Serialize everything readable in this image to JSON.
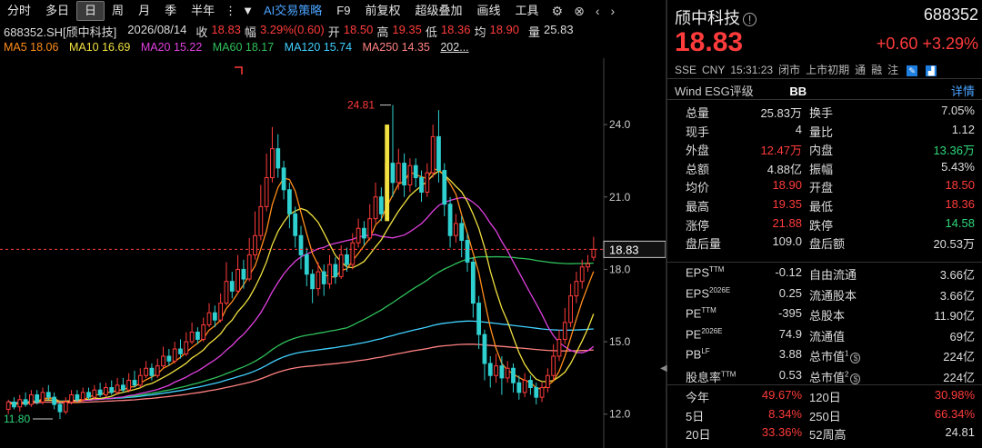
{
  "toolbar": {
    "items": [
      "分时",
      "多日",
      "日",
      "周",
      "月",
      "季",
      "半年",
      "⋮",
      "▼",
      "AI交易策略",
      "F9",
      "前复权",
      "超级叠加",
      "画线",
      "工具"
    ],
    "active": "日"
  },
  "info": {
    "code": "688352.SH[颀中科技]",
    "date": "2026/08/14",
    "close_label": "收",
    "close": "18.83",
    "amp_label": "幅",
    "amp": "3.29%(0.60)",
    "open_label": "开",
    "open": "18.50",
    "high_label": "高",
    "high": "19.35",
    "low_label": "低",
    "low": "18.36",
    "avg_label": "均",
    "avg": "18.90",
    "vol_label": "量",
    "vol": "25.83"
  },
  "ma": {
    "ma5": "MA5 18.06",
    "ma10": "MA10 16.69",
    "ma20": "MA20 15.22",
    "ma60": "MA60 18.17",
    "ma120": "MA120 15.74",
    "ma250": "MA250 14.35",
    "more": "202..."
  },
  "colors": {
    "up": "#ff3b3b",
    "down": "#2fd0d0",
    "ma5": "#ff8c1a",
    "ma10": "#f0e040",
    "ma20": "#e040e0",
    "ma60": "#2fc05a",
    "ma120": "#40d0ff",
    "ma250": "#ff8080"
  },
  "chart_data": {
    "type": "candlestick",
    "yticks": [
      "24.0",
      "21.0",
      "18.0",
      "15.0",
      "12.0"
    ],
    "ylim": [
      11.5,
      26.0
    ],
    "current_price_label": "18.83",
    "high_marker": "24.81",
    "low_marker": "11.80",
    "candles": [
      [
        12.2,
        12.5,
        12.0,
        12.6
      ],
      [
        12.5,
        12.3,
        12.2,
        12.7
      ],
      [
        12.3,
        12.6,
        12.1,
        12.8
      ],
      [
        12.6,
        12.4,
        12.3,
        12.9
      ],
      [
        12.4,
        12.8,
        12.3,
        13.0
      ],
      [
        12.8,
        12.5,
        12.4,
        13.0
      ],
      [
        12.5,
        12.9,
        12.4,
        13.1
      ],
      [
        12.9,
        12.7,
        12.6,
        13.2
      ],
      [
        12.7,
        12.4,
        12.2,
        12.9
      ],
      [
        12.4,
        12.1,
        11.8,
        12.5
      ],
      [
        12.1,
        12.5,
        12.0,
        12.7
      ],
      [
        12.5,
        12.8,
        12.4,
        13.0
      ],
      [
        12.8,
        12.6,
        12.5,
        13.0
      ],
      [
        12.6,
        12.9,
        12.5,
        13.1
      ],
      [
        12.9,
        12.7,
        12.6,
        13.1
      ],
      [
        12.7,
        13.0,
        12.6,
        13.2
      ],
      [
        13.0,
        12.8,
        12.7,
        13.3
      ],
      [
        12.8,
        13.1,
        12.7,
        13.3
      ],
      [
        13.1,
        12.9,
        12.8,
        13.4
      ],
      [
        12.9,
        13.2,
        12.8,
        13.5
      ],
      [
        13.2,
        13.0,
        12.9,
        13.5
      ],
      [
        13.0,
        13.4,
        12.9,
        13.7
      ],
      [
        13.4,
        13.2,
        13.1,
        13.8
      ],
      [
        13.2,
        13.6,
        13.1,
        13.9
      ],
      [
        13.6,
        13.9,
        13.5,
        14.2
      ],
      [
        13.9,
        13.6,
        13.4,
        14.1
      ],
      [
        13.6,
        14.0,
        13.5,
        14.3
      ],
      [
        14.0,
        14.4,
        13.9,
        14.8
      ],
      [
        14.4,
        14.2,
        14.0,
        14.7
      ],
      [
        14.2,
        14.7,
        14.1,
        15.0
      ],
      [
        14.7,
        14.5,
        14.3,
        15.1
      ],
      [
        14.5,
        15.0,
        14.4,
        15.4
      ],
      [
        15.0,
        15.4,
        14.9,
        15.8
      ],
      [
        15.4,
        15.1,
        14.9,
        15.6
      ],
      [
        15.1,
        15.7,
        15.0,
        16.0
      ],
      [
        15.7,
        16.2,
        15.6,
        16.6
      ],
      [
        16.2,
        15.9,
        15.6,
        16.5
      ],
      [
        15.9,
        16.6,
        15.8,
        17.0
      ],
      [
        16.6,
        17.5,
        16.5,
        18.3
      ],
      [
        17.5,
        17.1,
        16.8,
        17.9
      ],
      [
        17.1,
        18.0,
        17.0,
        18.6
      ],
      [
        18.0,
        17.6,
        17.2,
        18.4
      ],
      [
        17.6,
        18.6,
        17.5,
        19.3
      ],
      [
        18.6,
        19.4,
        18.4,
        20.4
      ],
      [
        19.4,
        20.6,
        19.2,
        21.5
      ],
      [
        20.6,
        21.8,
        20.4,
        22.8
      ],
      [
        21.8,
        23.0,
        21.6,
        23.9
      ],
      [
        23.0,
        22.2,
        21.8,
        23.6
      ],
      [
        22.2,
        21.3,
        20.9,
        22.5
      ],
      [
        21.3,
        20.3,
        19.7,
        21.6
      ],
      [
        20.3,
        19.4,
        18.9,
        20.6
      ],
      [
        19.4,
        18.6,
        18.0,
        19.8
      ],
      [
        18.6,
        17.8,
        17.3,
        18.9
      ],
      [
        17.8,
        17.2,
        16.6,
        18.0
      ],
      [
        17.2,
        17.9,
        16.9,
        18.3
      ],
      [
        17.9,
        17.4,
        16.9,
        18.2
      ],
      [
        17.4,
        18.2,
        17.2,
        18.6
      ],
      [
        18.2,
        17.7,
        17.4,
        18.5
      ],
      [
        17.7,
        18.6,
        17.6,
        19.0
      ],
      [
        18.6,
        18.2,
        17.9,
        18.9
      ],
      [
        18.2,
        19.1,
        18.0,
        19.5
      ],
      [
        19.1,
        19.7,
        18.9,
        20.1
      ],
      [
        19.7,
        19.3,
        19.0,
        20.0
      ],
      [
        19.3,
        20.1,
        19.2,
        20.7
      ],
      [
        20.1,
        21.0,
        19.9,
        21.6
      ],
      [
        21.0,
        20.3,
        20.0,
        21.4
      ],
      [
        20.3,
        22.4,
        20.2,
        24.0
      ],
      [
        22.4,
        21.6,
        21.0,
        24.81
      ],
      [
        21.6,
        22.4,
        21.3,
        23.0
      ],
      [
        22.4,
        21.5,
        21.0,
        22.8
      ],
      [
        21.5,
        22.3,
        21.2,
        22.6
      ],
      [
        22.3,
        21.8,
        21.4,
        22.6
      ],
      [
        21.8,
        21.2,
        20.8,
        22.1
      ],
      [
        21.2,
        22.0,
        21.0,
        22.4
      ],
      [
        22.0,
        23.5,
        21.8,
        24.0
      ],
      [
        23.5,
        22.1,
        21.6,
        24.6
      ],
      [
        22.1,
        20.7,
        20.2,
        22.4
      ],
      [
        20.7,
        19.4,
        18.9,
        21.0
      ],
      [
        19.4,
        19.9,
        19.1,
        20.3
      ],
      [
        19.9,
        19.2,
        18.5,
        20.2
      ],
      [
        19.2,
        18.3,
        17.9,
        19.5
      ],
      [
        18.3,
        16.6,
        16.0,
        18.5
      ],
      [
        16.6,
        15.3,
        14.7,
        16.9
      ],
      [
        15.3,
        14.1,
        13.4,
        15.5
      ],
      [
        14.1,
        13.6,
        13.1,
        14.4
      ],
      [
        13.6,
        14.0,
        13.3,
        14.5
      ],
      [
        14.0,
        13.5,
        12.8,
        14.4
      ],
      [
        13.5,
        13.9,
        13.3,
        14.2
      ],
      [
        13.9,
        13.3,
        12.9,
        14.1
      ],
      [
        13.3,
        12.9,
        12.6,
        13.6
      ],
      [
        12.9,
        13.4,
        12.7,
        13.7
      ],
      [
        13.4,
        13.1,
        12.8,
        13.6
      ],
      [
        13.1,
        12.7,
        12.4,
        13.3
      ],
      [
        12.7,
        13.1,
        12.5,
        13.3
      ],
      [
        13.1,
        13.6,
        12.9,
        13.9
      ],
      [
        13.6,
        14.4,
        13.4,
        14.9
      ],
      [
        14.4,
        15.1,
        14.2,
        15.5
      ],
      [
        15.1,
        15.8,
        14.9,
        16.4
      ],
      [
        15.8,
        16.9,
        15.6,
        17.4
      ],
      [
        16.9,
        17.5,
        16.6,
        17.9
      ],
      [
        17.5,
        18.1,
        17.2,
        18.4
      ],
      [
        18.1,
        18.23,
        17.9,
        18.6
      ],
      [
        18.5,
        18.83,
        18.36,
        19.35
      ]
    ]
  },
  "panel": {
    "name": "颀中科技",
    "code": "688352",
    "price": "18.83",
    "change": "+0.60",
    "change_pct": "+3.29%",
    "meta": [
      "SSE",
      "CNY",
      "15:31:23",
      "闭市",
      "上市初期",
      "通",
      "融",
      "注"
    ],
    "esg_label": "Wind ESG评级",
    "esg_value": "BB",
    "esg_link": "详情",
    "rows": [
      {
        "l1": "总量",
        "v1": "25.83万",
        "c1": "white",
        "l2": "换手",
        "v2": "7.05%",
        "c2": "white"
      },
      {
        "l1": "现手",
        "v1": "4",
        "c1": "white",
        "l2": "量比",
        "v2": "1.12",
        "c2": "white"
      },
      {
        "l1": "外盘",
        "v1": "12.47万",
        "c1": "red",
        "l2": "内盘",
        "v2": "13.36万",
        "c2": "green"
      },
      {
        "l1": "总额",
        "v1": "4.88亿",
        "c1": "white",
        "l2": "振幅",
        "v2": "5.43%",
        "c2": "white"
      },
      {
        "l1": "均价",
        "v1": "18.90",
        "c1": "red",
        "l2": "开盘",
        "v2": "18.50",
        "c2": "red"
      },
      {
        "l1": "最高",
        "v1": "19.35",
        "c1": "red",
        "l2": "最低",
        "v2": "18.36",
        "c2": "red"
      },
      {
        "l1": "涨停",
        "v1": "21.88",
        "c1": "red",
        "l2": "跌停",
        "v2": "14.58",
        "c2": "green"
      },
      {
        "l1": "盘后量",
        "v1": "109.0",
        "c1": "white",
        "l2": "盘后额",
        "v2": "20.53万",
        "c2": "white"
      }
    ],
    "rows2": [
      {
        "l1": "EPS",
        "s1": "TTM",
        "v1": "-0.12",
        "l2": "自由流通",
        "v2": "3.66亿"
      },
      {
        "l1": "EPS",
        "s1": "2026E",
        "v1": "0.25",
        "l2": "流通股本",
        "v2": "3.66亿"
      },
      {
        "l1": "PE",
        "s1": "TTM",
        "v1": "-395",
        "l2": "总股本",
        "v2": "11.90亿"
      },
      {
        "l1": "PE",
        "s1": "2026E",
        "v1": "74.9",
        "l2": "流通值",
        "v2": "69亿"
      },
      {
        "l1": "PB",
        "s1": "LF",
        "v1": "3.88",
        "l2": "总市值",
        "s2": "1",
        "v2": "224亿"
      },
      {
        "l1": "股息率",
        "s1": "TTM",
        "v1": "0.53",
        "l2": "总市值",
        "s2": "2",
        "v2": "224亿"
      }
    ],
    "rows3": [
      {
        "l1": "今年",
        "v1": "49.67%",
        "l2": "120日",
        "v2": "30.98%"
      },
      {
        "l1": "5日",
        "v1": "8.34%",
        "l2": "250日",
        "v2": "66.34%"
      },
      {
        "l1": "20日",
        "v1": "33.36%",
        "l2": "52周高",
        "v2": "24.81"
      }
    ]
  }
}
